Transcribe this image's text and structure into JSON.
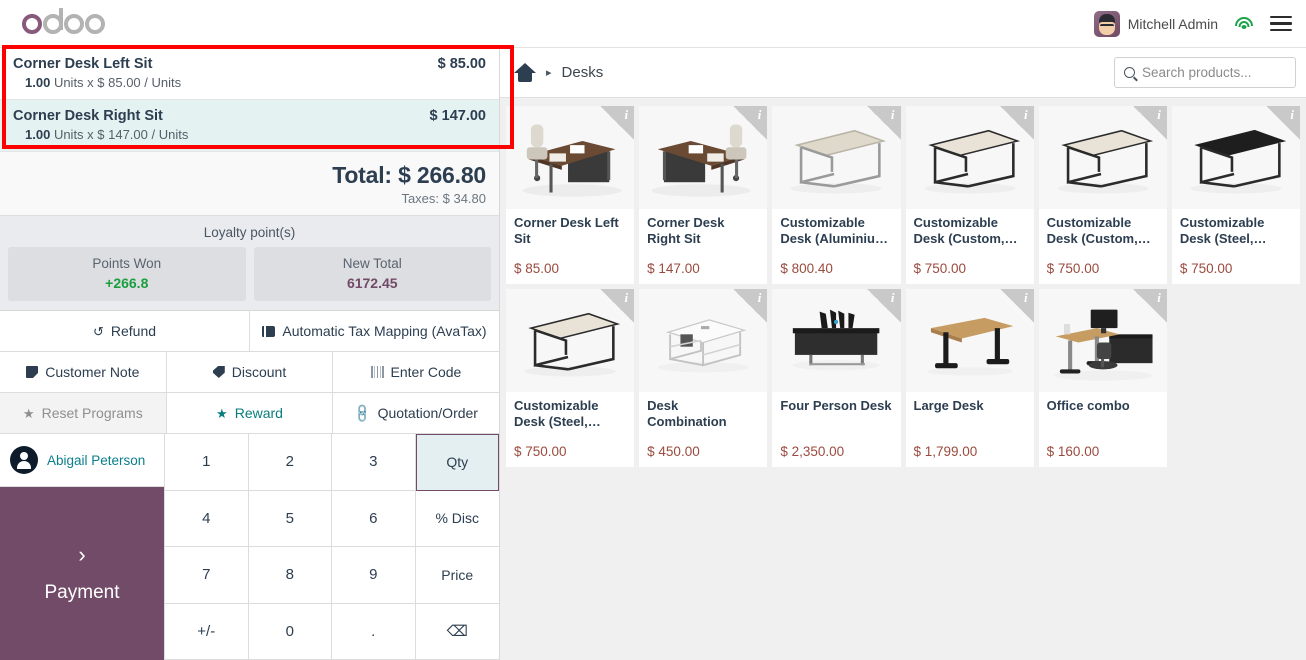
{
  "app": {
    "logo_text": "odoo",
    "accent_plum": "#714B67",
    "accent_teal": "#087d7d"
  },
  "topbar": {
    "user_name": "Mitchell Admin",
    "wifi_icon": "wifi-icon",
    "menu_icon": "hamburger-menu-icon",
    "avatar_icon": "user-avatar"
  },
  "order": {
    "lines": [
      {
        "name": "Corner Desk Left Sit",
        "price": "$ 85.00",
        "qty": "1.00",
        "detail": "Units x $ 85.00 / Units",
        "selected": false
      },
      {
        "name": "Corner Desk Right Sit",
        "price": "$ 147.00",
        "qty": "1.00",
        "detail": "Units x $ 147.00 / Units",
        "selected": true
      }
    ],
    "total_label": "Total: $ 266.80",
    "taxes_label": "Taxes: $ 34.80"
  },
  "loyalty": {
    "title": "Loyalty point(s)",
    "points_won_label": "Points Won",
    "points_won_value": "+266.8",
    "new_total_label": "New Total",
    "new_total_value": "6172.45"
  },
  "controls": {
    "refund": "Refund",
    "tax_mapping": "Automatic Tax Mapping (AvaTax)",
    "customer_note": "Customer Note",
    "discount": "Discount",
    "enter_code": "Enter Code",
    "reset_programs": "Reset Programs",
    "reward": "Reward",
    "quotation_order": "Quotation/Order"
  },
  "customer": {
    "name": "Abigail Peterson"
  },
  "payment": {
    "label": "Payment",
    "chevron": "›"
  },
  "numpad": {
    "keys": [
      {
        "label": "1",
        "mode": false,
        "active": false
      },
      {
        "label": "2",
        "mode": false,
        "active": false
      },
      {
        "label": "3",
        "mode": false,
        "active": false
      },
      {
        "label": "Qty",
        "mode": true,
        "active": true
      },
      {
        "label": "4",
        "mode": false,
        "active": false
      },
      {
        "label": "5",
        "mode": false,
        "active": false
      },
      {
        "label": "6",
        "mode": false,
        "active": false
      },
      {
        "label": "% Disc",
        "mode": true,
        "active": false
      },
      {
        "label": "7",
        "mode": false,
        "active": false
      },
      {
        "label": "8",
        "mode": false,
        "active": false
      },
      {
        "label": "9",
        "mode": false,
        "active": false
      },
      {
        "label": "Price",
        "mode": true,
        "active": false
      },
      {
        "label": "+/-",
        "mode": false,
        "active": false
      },
      {
        "label": "0",
        "mode": false,
        "active": false
      },
      {
        "label": ".",
        "mode": false,
        "active": false
      },
      {
        "label": "⌫",
        "mode": false,
        "active": false
      }
    ]
  },
  "subheader": {
    "home_icon": "home-icon",
    "separator": "▸",
    "category": "Desks",
    "search_placeholder": "Search products...",
    "search_value": ""
  },
  "products": [
    {
      "name": "Corner Desk Left Sit",
      "price": "$ 85.00",
      "image": "corner-desk-left",
      "info_badge": "i"
    },
    {
      "name": "Corner Desk Right Sit",
      "price": "$ 147.00",
      "image": "corner-desk-right",
      "info_badge": "i"
    },
    {
      "name": "Customizable Desk (Aluminiu…",
      "price": "$ 800.40",
      "image": "desk-light-frame",
      "info_badge": "i"
    },
    {
      "name": "Customizable Desk (Custom,…",
      "price": "$ 750.00",
      "image": "desk-black-frame",
      "info_badge": "i"
    },
    {
      "name": "Customizable Desk (Custom,…",
      "price": "$ 750.00",
      "image": "desk-black-frame",
      "info_badge": "i"
    },
    {
      "name": "Customizable Desk (Steel,…",
      "price": "$ 750.00",
      "image": "desk-black-top",
      "info_badge": "i"
    },
    {
      "name": "Customizable Desk (Steel,…",
      "price": "$ 750.00",
      "image": "desk-black-frame",
      "info_badge": "i"
    },
    {
      "name": "Desk Combination",
      "price": "$ 450.00",
      "image": "desk-combination",
      "info_badge": "i"
    },
    {
      "name": "Four Person Desk",
      "price": "$ 2,350.00",
      "image": "four-person-desk",
      "info_badge": "i"
    },
    {
      "name": "Large Desk",
      "price": "$ 1,799.00",
      "image": "large-desk",
      "info_badge": "i"
    },
    {
      "name": "Office combo",
      "price": "$ 160.00",
      "image": "office-combo",
      "info_badge": "i"
    }
  ],
  "annotation": {
    "highlight_color": "#ff0000",
    "target": "order-lines-highlight"
  }
}
